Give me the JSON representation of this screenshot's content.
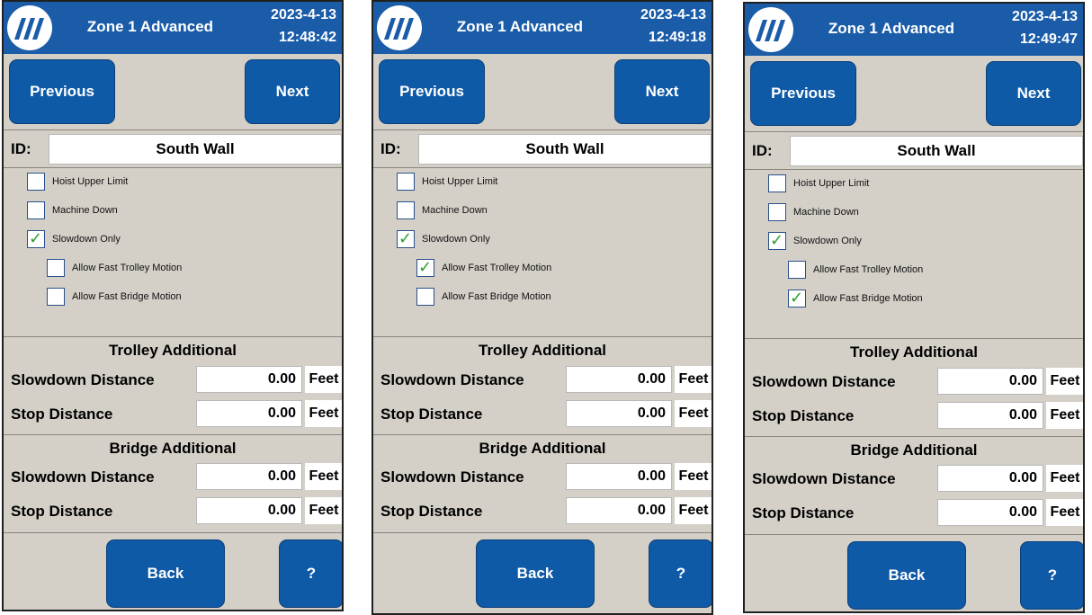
{
  "colors": {
    "header_blue": "#1a5ca8",
    "button_blue": "#0f5aa6",
    "panel_gray": "#d4d0c8",
    "check_green": "#2e9c2e"
  },
  "screens": [
    {
      "title": "Zone 1 Advanced",
      "date": "2023-4-13",
      "time": "12:48:42",
      "previous_label": "Previous",
      "next_label": "Next",
      "id_label": "ID:",
      "id_value": "South Wall",
      "checkboxes": [
        {
          "label": "Hoist Upper Limit",
          "checked": false,
          "indent": 0
        },
        {
          "label": "Machine Down",
          "checked": false,
          "indent": 0
        },
        {
          "label": "Slowdown Only",
          "checked": true,
          "indent": 0
        },
        {
          "label": "Allow Fast Trolley Motion",
          "checked": false,
          "indent": 1
        },
        {
          "label": "Allow Fast Bridge Motion",
          "checked": false,
          "indent": 1
        }
      ],
      "trolley_title": "Trolley Additional",
      "bridge_title": "Bridge Additional",
      "trolley_slowdown_label": "Slowdown Distance",
      "trolley_slowdown_value": "0.00",
      "trolley_slowdown_unit": "Feet",
      "trolley_stop_label": "Stop Distance",
      "trolley_stop_value": "0.00",
      "trolley_stop_unit": "Feet",
      "bridge_slowdown_label": "Slowdown Distance",
      "bridge_slowdown_value": "0.00",
      "bridge_slowdown_unit": "Feet",
      "bridge_stop_label": "Stop Distance",
      "bridge_stop_value": "0.00",
      "bridge_stop_unit": "Feet",
      "back_label": "Back",
      "help_label": "?"
    },
    {
      "title": "Zone 1 Advanced",
      "date": "2023-4-13",
      "time": "12:49:18",
      "previous_label": "Previous",
      "next_label": "Next",
      "id_label": "ID:",
      "id_value": "South Wall",
      "checkboxes": [
        {
          "label": "Hoist Upper Limit",
          "checked": false,
          "indent": 0
        },
        {
          "label": "Machine Down",
          "checked": false,
          "indent": 0
        },
        {
          "label": "Slowdown Only",
          "checked": true,
          "indent": 0
        },
        {
          "label": "Allow Fast Trolley Motion",
          "checked": true,
          "indent": 1
        },
        {
          "label": "Allow Fast Bridge Motion",
          "checked": false,
          "indent": 1
        }
      ],
      "trolley_title": "Trolley Additional",
      "bridge_title": "Bridge Additional",
      "trolley_slowdown_label": "Slowdown Distance",
      "trolley_slowdown_value": "0.00",
      "trolley_slowdown_unit": "Feet",
      "trolley_stop_label": "Stop Distance",
      "trolley_stop_value": "0.00",
      "trolley_stop_unit": "Feet",
      "bridge_slowdown_label": "Slowdown Distance",
      "bridge_slowdown_value": "0.00",
      "bridge_slowdown_unit": "Feet",
      "bridge_stop_label": "Stop Distance",
      "bridge_stop_value": "0.00",
      "bridge_stop_unit": "Feet",
      "back_label": "Back",
      "help_label": "?"
    },
    {
      "title": "Zone 1 Advanced",
      "date": "2023-4-13",
      "time": "12:49:47",
      "previous_label": "Previous",
      "next_label": "Next",
      "id_label": "ID:",
      "id_value": "South Wall",
      "checkboxes": [
        {
          "label": "Hoist Upper Limit",
          "checked": false,
          "indent": 0
        },
        {
          "label": "Machine Down",
          "checked": false,
          "indent": 0
        },
        {
          "label": "Slowdown Only",
          "checked": true,
          "indent": 0
        },
        {
          "label": "Allow Fast Trolley Motion",
          "checked": false,
          "indent": 1
        },
        {
          "label": "Allow Fast Bridge Motion",
          "checked": true,
          "indent": 1
        }
      ],
      "trolley_title": "Trolley Additional",
      "bridge_title": "Bridge Additional",
      "trolley_slowdown_label": "Slowdown Distance",
      "trolley_slowdown_value": "0.00",
      "trolley_slowdown_unit": "Feet",
      "trolley_stop_label": "Stop Distance",
      "trolley_stop_value": "0.00",
      "trolley_stop_unit": "Feet",
      "bridge_slowdown_label": "Slowdown Distance",
      "bridge_slowdown_value": "0.00",
      "bridge_slowdown_unit": "Feet",
      "bridge_stop_label": "Stop Distance",
      "bridge_stop_value": "0.00",
      "bridge_stop_unit": "Feet",
      "back_label": "Back",
      "help_label": "?"
    }
  ]
}
